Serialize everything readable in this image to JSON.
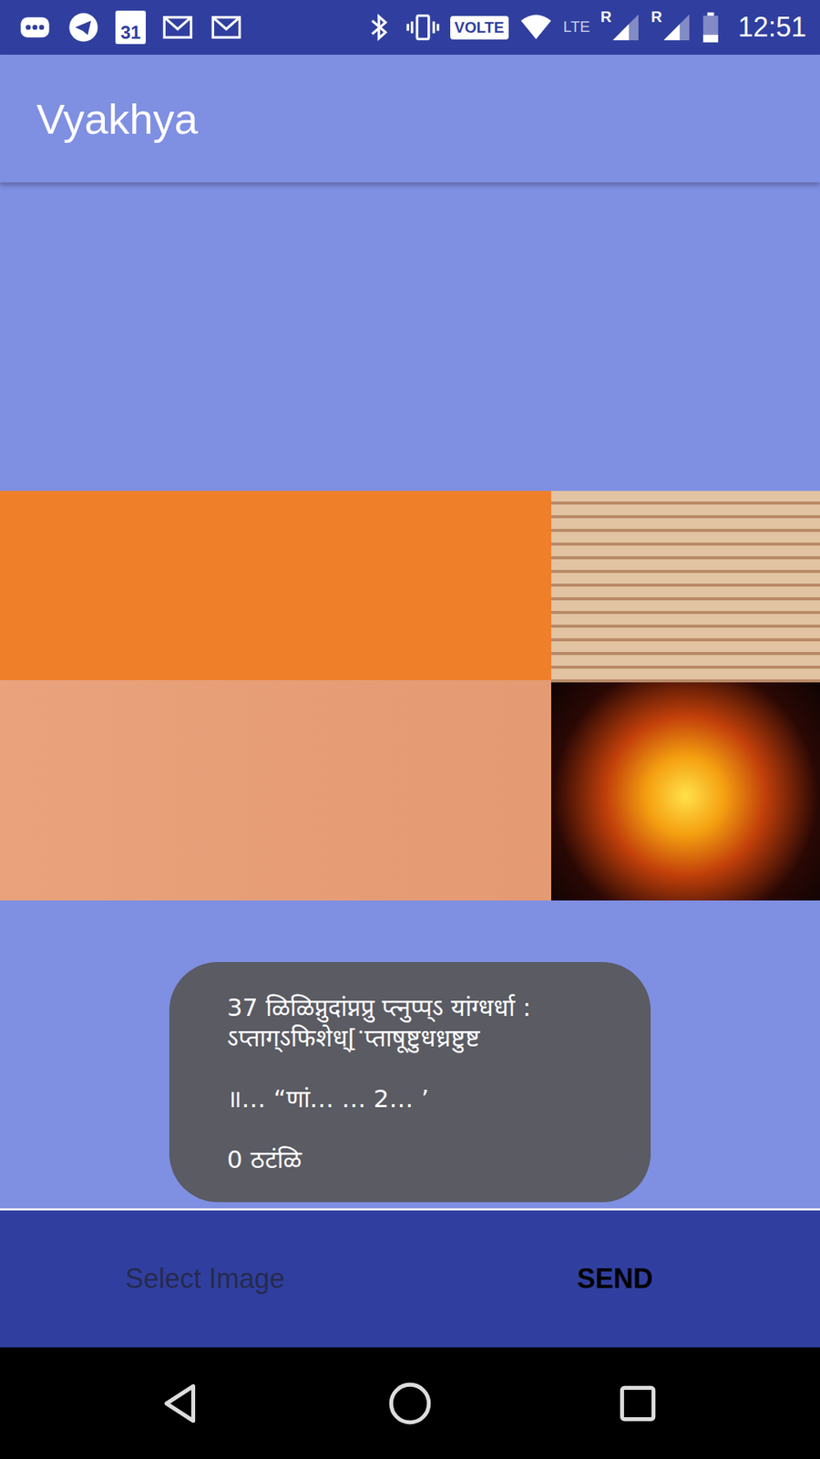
{
  "status_bar": {
    "calendar_day": "31",
    "network_badge": "VOLTE",
    "lte": "LTE",
    "roaming": [
      "R",
      "R"
    ],
    "battery": {
      "level": 0.3
    },
    "time": "12:51"
  },
  "app_bar": {
    "title": "Vyakhya"
  },
  "toast": {
    "paragraphs": [
      [
        "37 ळिळिप्नुदांप्नप्रु प्त्नुप्प्ऽ यांग्धर्धा :",
        "ऽप्ताग्ऽफिशेध्[ॱप्ताषूष्टुधध्रष्टुष्ट"
      ],
      [
        "॥… “णां… … 2… ’"
      ],
      [
        "0 ठटंळि"
      ]
    ]
  },
  "bottom_bar": {
    "buttons": [
      {
        "label": "Select Image",
        "disabled": true
      },
      {
        "label": "SEND",
        "disabled": false
      }
    ]
  }
}
